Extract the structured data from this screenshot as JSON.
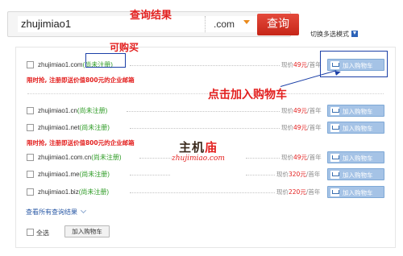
{
  "search": {
    "query": "zhujimiao1",
    "tld": ".com",
    "button_label": "查询",
    "switch_mode_label": "切换多选模式"
  },
  "annotations": {
    "title": "查询结果",
    "available": "可购买",
    "add_to_cart_hint": "点击加入购物车"
  },
  "promo_text": "限时抢, 注册即送价值800元的企业邮箱",
  "results": [
    {
      "domain": "zhujimiao1.com",
      "status": "(尚未注册)",
      "price_prefix": "现价",
      "price": "49元",
      "price_suffix": "/首年",
      "cart_label": "加入购物车"
    },
    {
      "domain": "zhujimiao1.cn",
      "status": "(尚未注册)",
      "price_prefix": "现价",
      "price": "49元",
      "price_suffix": "/首年",
      "cart_label": "加入购物车"
    },
    {
      "domain": "zhujimiao1.net",
      "status": "(尚未注册)",
      "price_prefix": "现价",
      "price": "49元",
      "price_suffix": "/首年",
      "cart_label": "加入购物车"
    },
    {
      "domain": "zhujimiao1.com.cn",
      "status": "(尚未注册)",
      "price_prefix": "现价",
      "price": "49元",
      "price_suffix": "/首年",
      "cart_label": "加入购物车"
    },
    {
      "domain": "zhujimiao1.me",
      "status": "(尚未注册)",
      "price_prefix": "现价",
      "price": "320元",
      "price_suffix": "/首年",
      "cart_label": "加入购物车"
    },
    {
      "domain": "zhujimiao1.biz",
      "status": "(尚未注册)",
      "price_prefix": "现价",
      "price": "220元",
      "price_suffix": "/首年",
      "cart_label": "加入购物车"
    }
  ],
  "watermark": {
    "main_a": "主机",
    "main_b": "庙",
    "sub": "zhujimiao.com"
  },
  "footer": {
    "view_all": "查看所有查询结果",
    "select_all": "全选",
    "add_to_cart": "加入购物车"
  },
  "colors": {
    "accent_red": "#e3201f",
    "cart_blue": "#a5c3e6",
    "highlight_blue": "#1b3fa7",
    "status_green": "#2c9b23"
  }
}
